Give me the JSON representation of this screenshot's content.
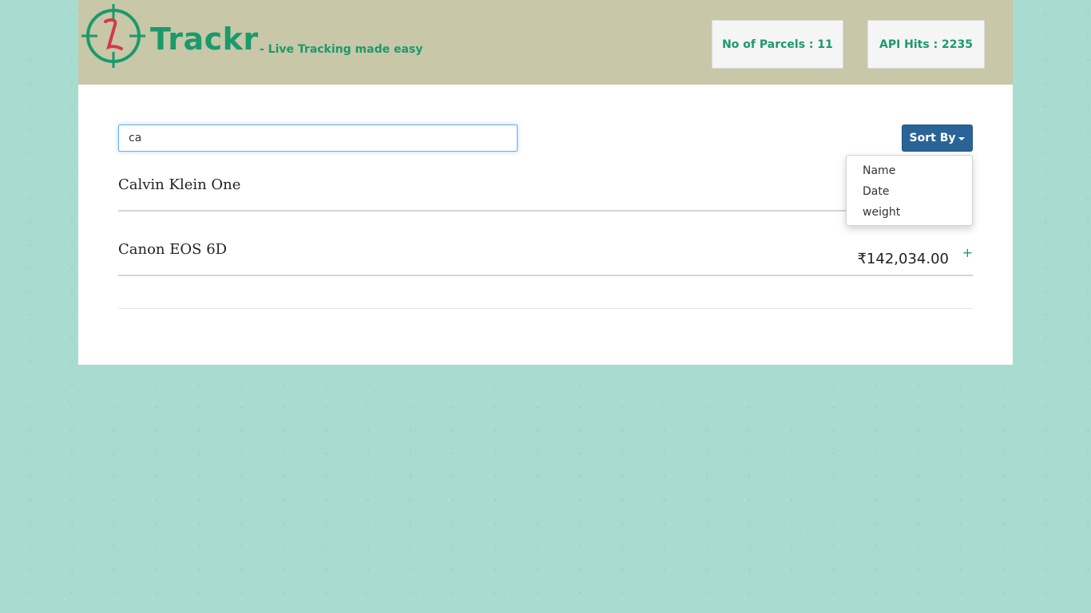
{
  "header": {
    "logo_text": "Trackr",
    "tagline": "- Live Tracking made easy",
    "parcels_label": "No of Parcels : 11",
    "api_hits_label": "API Hits : 2235"
  },
  "search": {
    "value": "ca"
  },
  "sort": {
    "label": "Sort By",
    "options": [
      "Name",
      "Date",
      "weight"
    ]
  },
  "items": [
    {
      "name": "Calvin Klein One",
      "price": "",
      "action": "+"
    },
    {
      "name": "Canon EOS 6D",
      "price": "₹142,034.00",
      "action": "+"
    }
  ],
  "icons": {
    "logo": "target-crosshair-icon",
    "expand": "plus-icon",
    "dropdown": "caret-down-icon"
  },
  "colors": {
    "brand": "#1a9a6c",
    "header_bg": "#c8c7a7",
    "page_bg": "#a8dcd0",
    "button_bg": "#2a6496"
  }
}
